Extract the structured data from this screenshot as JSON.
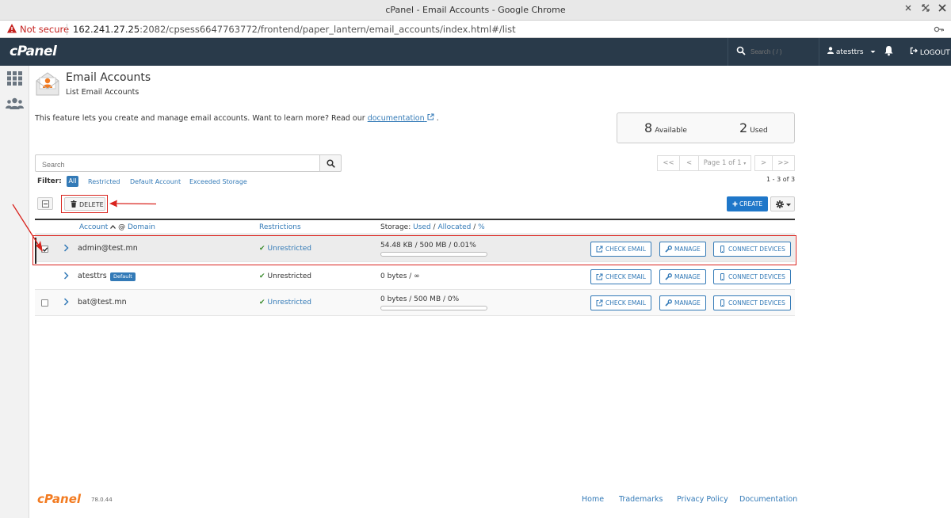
{
  "window": {
    "title": "cPanel - Email Accounts - Google Chrome"
  },
  "browser": {
    "security": "Not secure",
    "url_host": "162.241.27.25",
    "url_rest": ":2082/cpsess6647763772/frontend/paper_lantern/email_accounts/index.html#/list"
  },
  "header": {
    "logo": "cPanel",
    "search_placeholder": "Search ( / )",
    "user": "atesttrs",
    "logout": "LOGOUT"
  },
  "page": {
    "title": "Email Accounts",
    "subtitle": "List Email Accounts",
    "intro": "This feature lets you create and manage email accounts. Want to learn more? Read our",
    "intro_link": "documentation",
    "intro_end": "."
  },
  "stats": {
    "available_count": "8",
    "available_label": "Available",
    "used_count": "2",
    "used_label": "Used"
  },
  "search": {
    "placeholder": "Search"
  },
  "pagination": {
    "first": "<<",
    "prev": "<",
    "page": "Page 1 of 1",
    "next": ">",
    "last": ">>",
    "range": "1 - 3 of 3"
  },
  "filter": {
    "label": "Filter:",
    "all": "All",
    "restricted": "Restricted",
    "default_account": "Default Account",
    "exceeded_storage": "Exceeded Storage"
  },
  "toolbar": {
    "delete": "DELETE",
    "create": "CREATE"
  },
  "table": {
    "headers": {
      "account": "Account",
      "at": "@",
      "domain": "Domain",
      "restrictions": "Restrictions",
      "storage": "Storage:",
      "used": "Used",
      "allocated": "Allocated",
      "percent": "%"
    },
    "actions": {
      "check_email": "CHECK EMAIL",
      "manage": "MANAGE",
      "connect_devices": "CONNECT DEVICES"
    },
    "rows": [
      {
        "account": "admin@test.mn",
        "badge": "",
        "restriction": "Unrestricted",
        "storage": "54.48 KB / 500 MB / 0.01%",
        "usage_percent": 0.01,
        "checked": true
      },
      {
        "account": "atesttrs",
        "badge": "Default",
        "restriction": "Unrestricted",
        "storage": "0 bytes / ∞",
        "checked": false
      },
      {
        "account": "bat@test.mn",
        "badge": "",
        "restriction": "Unrestricted",
        "storage": "0 bytes / 500 MB / 0%",
        "usage_percent": 0,
        "checked": false
      }
    ]
  },
  "footer": {
    "logo": "cPanel",
    "version": "78.0.44",
    "links": [
      "Home",
      "Trademarks",
      "Privacy Policy",
      "Documentation"
    ]
  },
  "colors": {
    "header_bg": "#293a4a",
    "link": "#337ab7",
    "primary_button": "#1f77c9",
    "annotation": "#d9231d",
    "brand_orange": "#f27b21",
    "check_green": "#3c8d2f"
  }
}
